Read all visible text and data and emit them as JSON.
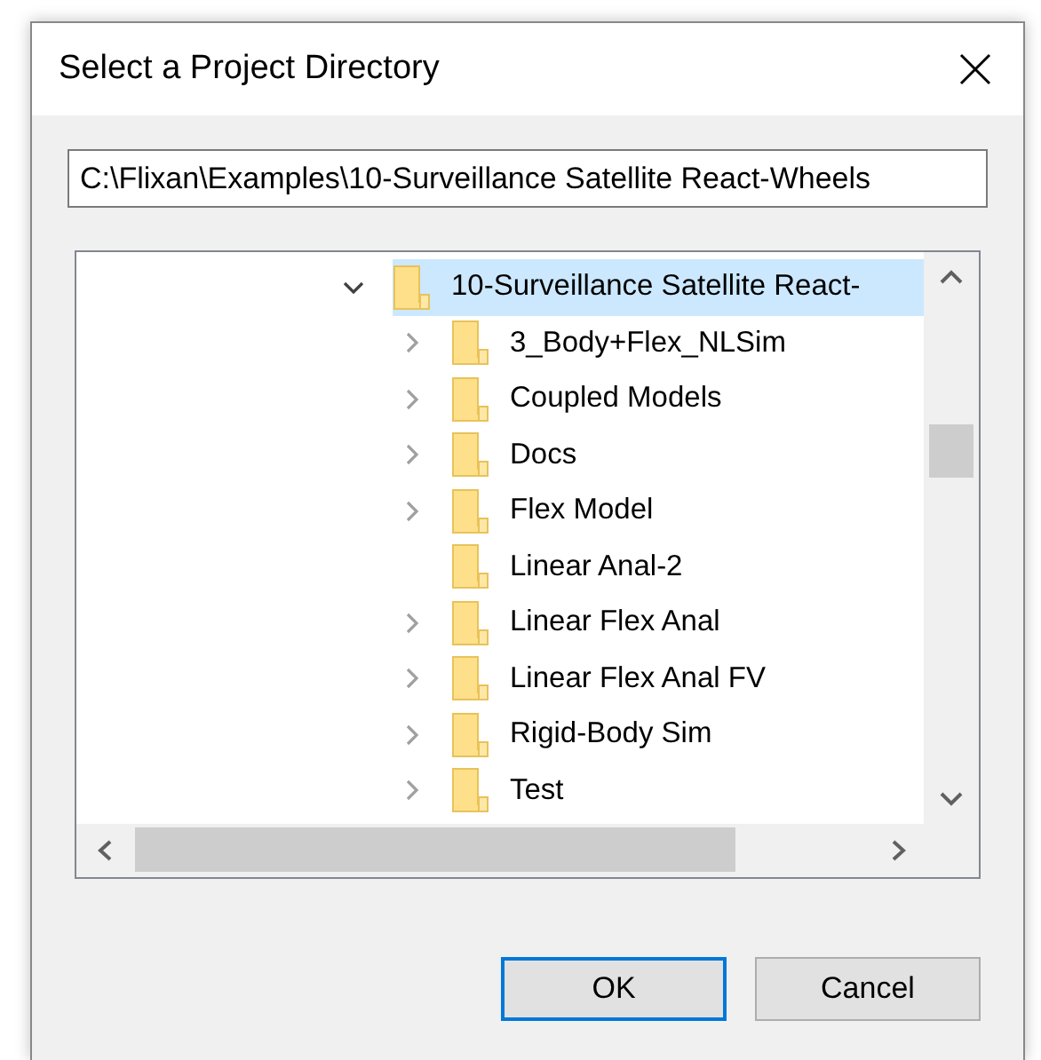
{
  "window": {
    "title": "Select a Project Directory"
  },
  "path_field": {
    "value": "C:\\Flixan\\Examples\\10-Surveillance Satellite React-Wheels"
  },
  "tree": {
    "items": [
      {
        "label": "10-Surveillance Satellite React-",
        "expandable": true,
        "expanded": true,
        "selected": true,
        "children": [
          {
            "label": "3_Body+Flex_NLSim",
            "expandable": true,
            "selected": false
          },
          {
            "label": "Coupled Models",
            "expandable": true,
            "selected": false
          },
          {
            "label": "Docs",
            "expandable": true,
            "selected": false
          },
          {
            "label": "Flex Model",
            "expandable": true,
            "selected": false
          },
          {
            "label": "Linear Anal-2",
            "expandable": false,
            "selected": false
          },
          {
            "label": "Linear Flex Anal",
            "expandable": true,
            "selected": false
          },
          {
            "label": "Linear Flex Anal FV",
            "expandable": true,
            "selected": false
          },
          {
            "label": "Rigid-Body Sim",
            "expandable": true,
            "selected": false
          },
          {
            "label": "Test",
            "expandable": true,
            "selected": false
          }
        ]
      }
    ]
  },
  "buttons": [
    {
      "label": "OK",
      "default": true
    },
    {
      "label": "Cancel",
      "default": false
    }
  ]
}
